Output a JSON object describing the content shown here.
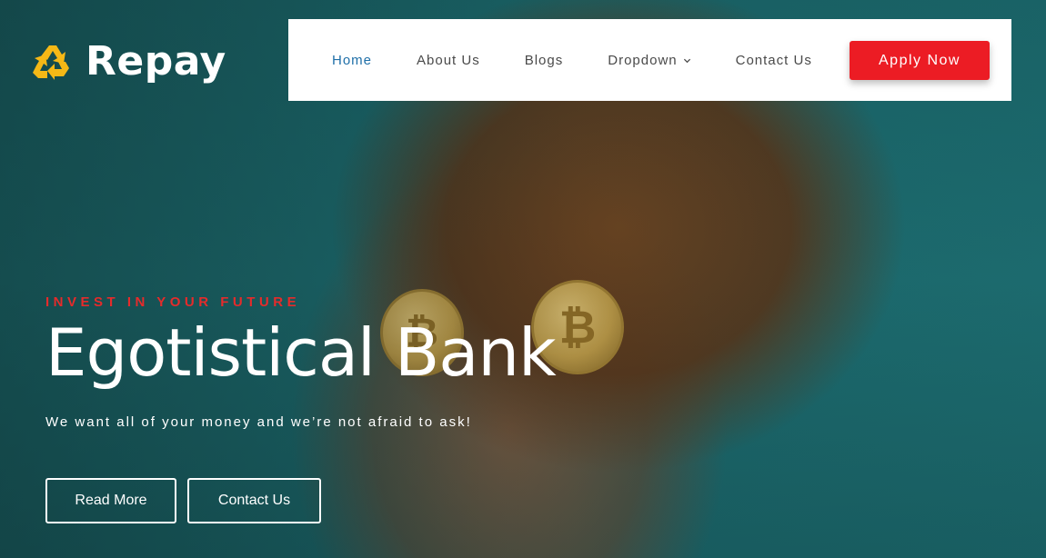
{
  "brand": {
    "name": "Repay",
    "logo_icon": "recycle-icon",
    "logo_color": "#f5b816"
  },
  "nav": {
    "items": [
      {
        "label": "Home",
        "active": true
      },
      {
        "label": "About Us",
        "active": false
      },
      {
        "label": "Blogs",
        "active": false
      },
      {
        "label": "Dropdown",
        "active": false,
        "icon": "chevron-down-icon"
      },
      {
        "label": "Contact Us",
        "active": false
      }
    ],
    "cta_label": "Apply Now",
    "cta_color": "#ec1c24",
    "active_color": "#1f6fa8"
  },
  "hero": {
    "eyebrow": "INVEST IN YOUR FUTURE",
    "eyebrow_color": "#e52b2b",
    "title": "Egotistical Bank",
    "subtitle": "We want all of your money and we’re not afraid to ask!",
    "buttons": {
      "primary": "Read More",
      "secondary": "Contact Us"
    },
    "coin_symbol": "₿"
  }
}
